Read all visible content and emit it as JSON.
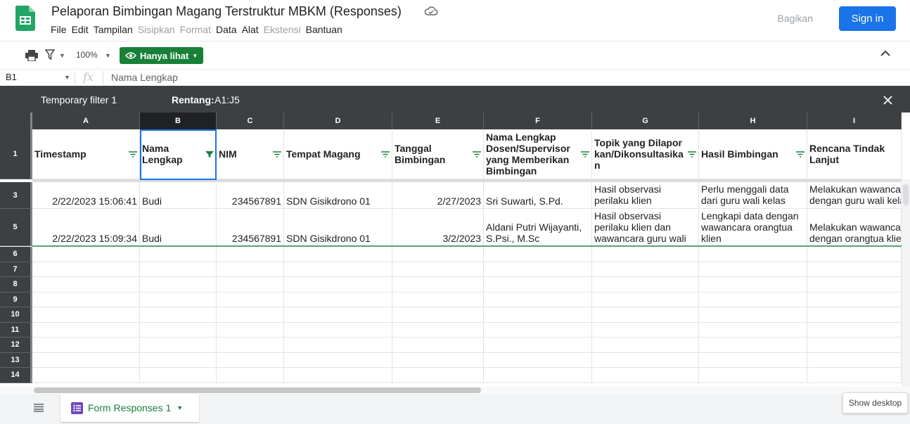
{
  "header": {
    "title": "Pelaporan Bimbingan Magang Terstruktur MBKM (Responses)",
    "menu": [
      {
        "label": "File",
        "disabled": false
      },
      {
        "label": "Edit",
        "disabled": false
      },
      {
        "label": "Tampilan",
        "disabled": false
      },
      {
        "label": "Sisipkan",
        "disabled": true
      },
      {
        "label": "Format",
        "disabled": true
      },
      {
        "label": "Data",
        "disabled": false
      },
      {
        "label": "Alat",
        "disabled": false
      },
      {
        "label": "Ekstensi",
        "disabled": true
      },
      {
        "label": "Bantuan",
        "disabled": false
      }
    ],
    "share_label": "Bagikan",
    "signin_label": "Sign in"
  },
  "toolbar": {
    "zoom": "100%",
    "view_mode_label": "Hanya lihat"
  },
  "formula_bar": {
    "cell_ref": "B1",
    "fx": "fx",
    "value": "Nama Lengkap"
  },
  "filter_bar": {
    "name": "Temporary filter 1",
    "range_label": "Rentang:",
    "range_value": "A1:J5"
  },
  "columns": [
    "A",
    "B",
    "C",
    "D",
    "E",
    "F",
    "G",
    "H",
    "I"
  ],
  "header_row": {
    "row_num": "1",
    "cells": [
      "Timestamp",
      "Nama Lengkap",
      "NIM",
      "Tempat Magang",
      "Tanggal Bimbingan",
      "Nama Lengkap Dosen/Supervisor yang Memberikan Bimbingan",
      "Topik yang Dilaporkan/Dikonsultasikan",
      "Hasil Bimbingan",
      "Rencana Tindak Lanjut"
    ]
  },
  "rows": [
    {
      "row_num": "3",
      "cells": [
        "2/22/2023 15:06:41",
        "Budi",
        "234567891",
        "SDN Gisikdrono 01",
        "2/27/2023",
        "Sri Suwarti, S.Pd.",
        "Hasil observasi perilaku klien",
        "Perlu menggali data dari guru wali kelas",
        "Melakukan wawancara dengan guru wali kelas"
      ]
    },
    {
      "row_num": "5",
      "cells": [
        "2/22/2023 15:09:34",
        "Budi",
        "234567891",
        "SDN Gisikdrono 01",
        "3/2/2023",
        "Aldani Putri Wijayanti, S.Psi., M.Sc",
        "Hasil observasi perilaku klien dan wawancara guru wali kelas",
        "Lengkapi data dengan wawancara orangtua klien",
        "Melakukan wawancara dengan orangtua klien"
      ]
    }
  ],
  "empty_rows": [
    "6",
    "7",
    "8",
    "9",
    "10",
    "11",
    "12",
    "13",
    "14"
  ],
  "sheet_tab": {
    "label": "Form Responses 1"
  },
  "tooltip": "Show desktop",
  "colors": {
    "accent_blue": "#1a73e8",
    "sheets_green": "#188038",
    "dark_header": "#3c4043"
  }
}
